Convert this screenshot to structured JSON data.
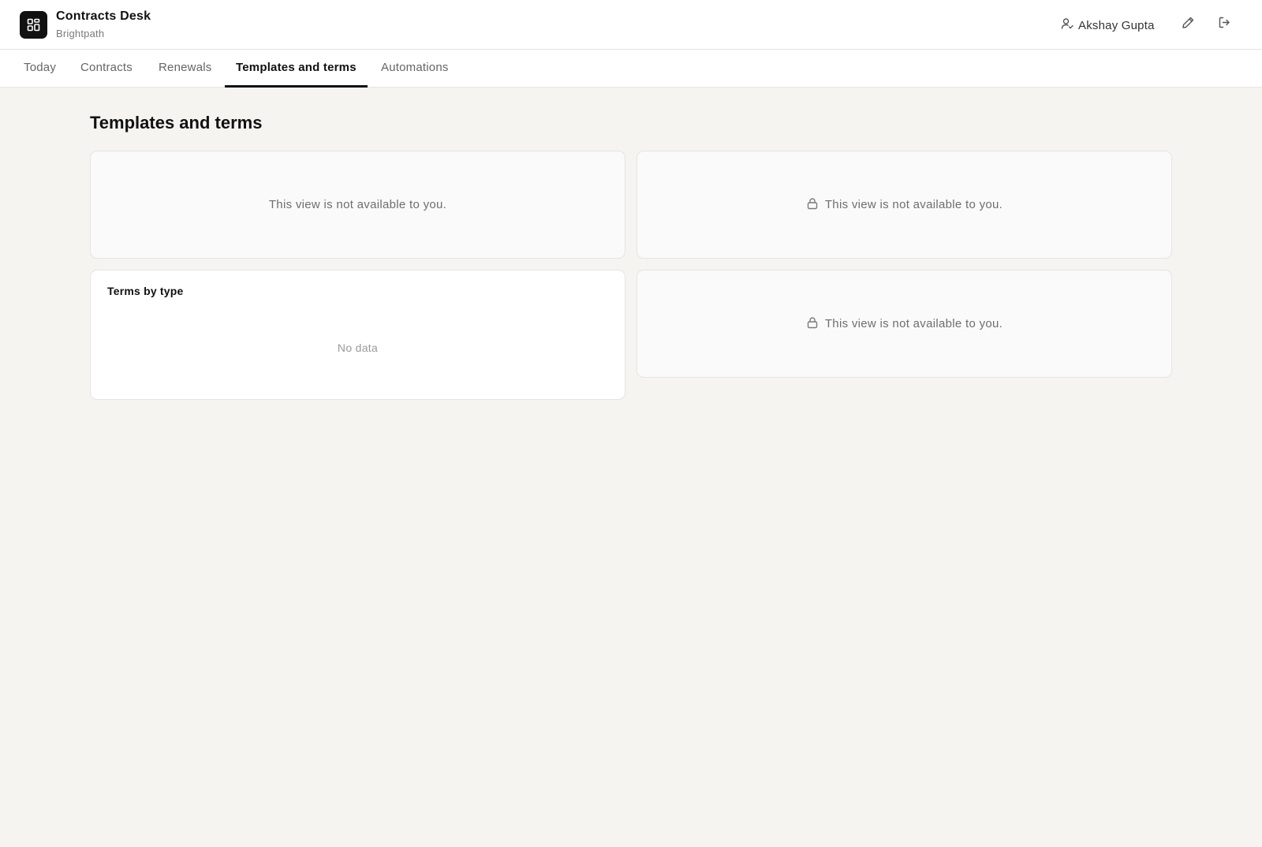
{
  "header": {
    "app_title": "Contracts Desk",
    "app_subtitle": "Brightpath",
    "logo_icon": "dashboard-grid-icon",
    "user_name": "Akshay Gupta",
    "user_icon": "user-check-icon",
    "edit_icon": "pencil-icon",
    "logout_icon": "logout-icon"
  },
  "tabs": [
    {
      "label": "Today",
      "active": false
    },
    {
      "label": "Contracts",
      "active": false
    },
    {
      "label": "Renewals",
      "active": false
    },
    {
      "label": "Templates and terms",
      "active": true
    },
    {
      "label": "Automations",
      "active": false
    }
  ],
  "main": {
    "page_title": "Templates and terms",
    "cards": [
      {
        "message": "This view is not available to you.",
        "locked_icon": false
      },
      {
        "message": "This view is not available to you.",
        "locked_icon": true
      },
      {
        "title": "Terms by type",
        "empty_text": "No data"
      },
      {
        "message": "This view is not available to you.",
        "locked_icon": true
      }
    ]
  },
  "colors": {
    "background": "#f5f4f1",
    "surface": "#ffffff",
    "accent": "#111111",
    "muted_text": "#6e6e6e"
  }
}
